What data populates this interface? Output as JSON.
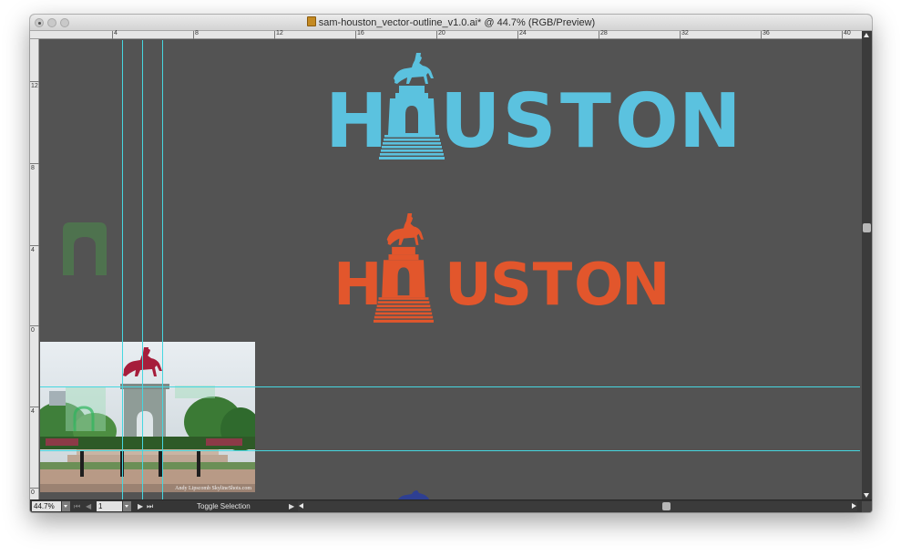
{
  "window": {
    "title": "sam-houston_vector-outline_v1.0.ai* @ 44.7% (RGB/Preview)"
  },
  "rulers": {
    "horizontal": [
      "4",
      "8",
      "12",
      "16",
      "20",
      "24",
      "28",
      "32",
      "36",
      "40"
    ],
    "vertical": [
      "12",
      "8",
      "4",
      "0",
      "4",
      "0"
    ]
  },
  "artboard": {
    "logo_blue": {
      "letters": [
        "H",
        "U",
        "S",
        "T",
        "O",
        "N"
      ],
      "color": "#5bc2df"
    },
    "logo_orange": {
      "letters": [
        "H",
        "U",
        "S",
        "T",
        "O",
        "N"
      ],
      "color": "#e2562c"
    },
    "logo_navy_color": "#2e3f92",
    "ghost_arch_color": "#4e7a4e",
    "photo_watermark": "Andy Lipscomb SkylineShots.com"
  },
  "statusbar": {
    "zoom": "44.7%",
    "page": "1",
    "status": "Toggle Selection"
  },
  "colors": {
    "guide": "#46d7e0",
    "canvas": "#535353"
  }
}
